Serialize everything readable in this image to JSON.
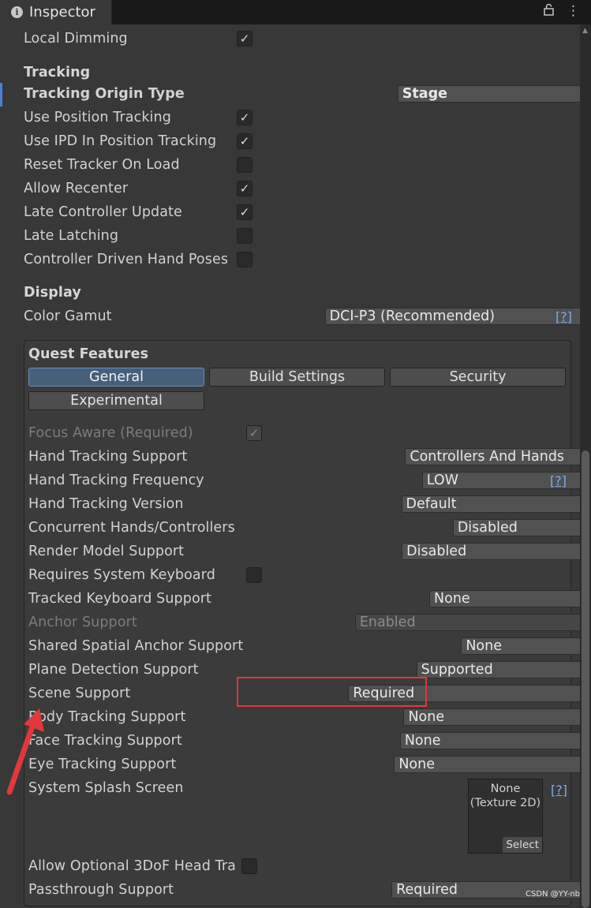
{
  "tab": {
    "title": "Inspector",
    "icon": "info-icon",
    "right_icons": [
      "lock-icon",
      "more-icon"
    ]
  },
  "top_rows": [
    {
      "label": "Local Dimming",
      "type": "check",
      "checked": true
    }
  ],
  "tracking": {
    "heading": "Tracking",
    "origin_label": "Tracking Origin Type",
    "origin_value": "Stage",
    "rows": [
      {
        "label": "Use Position Tracking",
        "checked": true
      },
      {
        "label": "Use IPD In Position Tracking",
        "checked": true
      },
      {
        "label": "Reset Tracker On Load",
        "checked": false
      },
      {
        "label": "Allow Recenter",
        "checked": true
      },
      {
        "label": "Late Controller Update",
        "checked": true
      },
      {
        "label": "Late Latching",
        "checked": false
      },
      {
        "label": "Controller Driven Hand Poses",
        "checked": false
      }
    ]
  },
  "display": {
    "heading": "Display",
    "gamut_label": "Color Gamut",
    "gamut_value": "DCI-P3 (Recommended)",
    "help": "[?]"
  },
  "quest": {
    "heading": "Quest Features",
    "tabs": [
      "General",
      "Build Settings",
      "Security",
      "Experimental"
    ],
    "active_tab": "General",
    "rows": [
      {
        "label": "Focus Aware (Required)",
        "type": "check",
        "checked": true,
        "disabled": true
      },
      {
        "label": "Hand Tracking Support",
        "type": "dropdown",
        "value": "Controllers And Hands"
      },
      {
        "label": "Hand Tracking Frequency",
        "type": "dropdown",
        "value": "LOW",
        "help": "[?]"
      },
      {
        "label": "Hand Tracking Version",
        "type": "dropdown",
        "value": "Default"
      },
      {
        "label": "Concurrent Hands/Controllers",
        "type": "dropdown",
        "value": "Disabled"
      },
      {
        "label": "Render Model Support",
        "type": "dropdown",
        "value": "Disabled"
      },
      {
        "label": "Requires System Keyboard",
        "type": "check",
        "checked": false
      },
      {
        "label": "Tracked Keyboard Support",
        "type": "dropdown",
        "value": "None"
      },
      {
        "label": "Anchor Support",
        "type": "dropdown",
        "value": "Enabled",
        "disabled": true
      },
      {
        "label": "Shared Spatial Anchor Support",
        "type": "dropdown",
        "value": "None"
      },
      {
        "label": "Plane Detection Support",
        "type": "dropdown",
        "value": "Supported"
      },
      {
        "label": "Scene Support",
        "type": "dropdown",
        "value": "Required"
      },
      {
        "label": "Body Tracking Support",
        "type": "dropdown",
        "value": "None"
      },
      {
        "label": "Face Tracking Support",
        "type": "dropdown",
        "value": "None"
      },
      {
        "label": "Eye Tracking Support",
        "type": "dropdown",
        "value": "None"
      }
    ],
    "splash": {
      "label": "System Splash Screen",
      "line1": "None",
      "line2": "(Texture 2D)",
      "select": "Select",
      "help": "[?]"
    },
    "allow_3dof_label": "Allow Optional 3DoF Head Tra",
    "passthrough_label": "Passthrough Support",
    "passthrough_value": "Required"
  },
  "annotation": {
    "highlight_color": "#e0383c"
  },
  "watermark": "CSDN @YY-nb"
}
